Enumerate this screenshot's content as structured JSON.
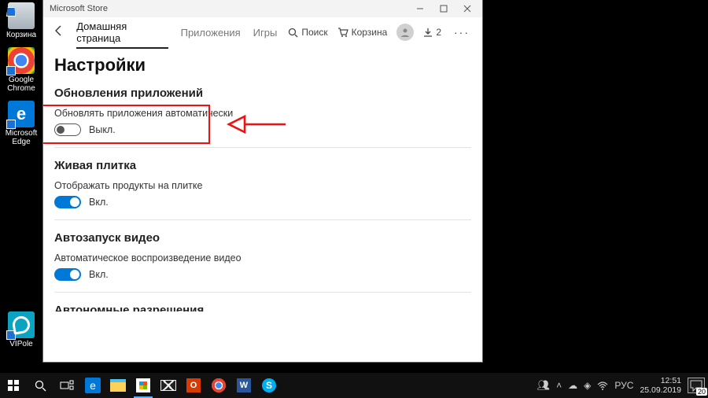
{
  "desktop": {
    "icons": [
      {
        "label": "Корзина"
      },
      {
        "label": "Google Chrome"
      },
      {
        "label": "Microsoft Edge"
      },
      {
        "label": "VIPole"
      }
    ]
  },
  "window": {
    "title": "Microsoft Store",
    "nav": {
      "tabs": [
        {
          "label": "Домашняя страница",
          "active": true
        },
        {
          "label": "Приложения",
          "active": false
        },
        {
          "label": "Игры",
          "active": false
        }
      ],
      "search": "Поиск",
      "cart": "Корзина",
      "downloads": "2"
    },
    "page_title": "Настройки",
    "sections": {
      "updates": {
        "heading": "Обновления приложений",
        "label": "Обновлять приложения автоматически",
        "state": "Выкл.",
        "on": false
      },
      "tile": {
        "heading": "Живая плитка",
        "label": "Отображать продукты на плитке",
        "state": "Вкл.",
        "on": true
      },
      "video": {
        "heading": "Автозапуск видео",
        "label": "Автоматическое воспроизведение видео",
        "state": "Вкл.",
        "on": true
      },
      "cutoff_heading": "Автономные разрешения"
    }
  },
  "taskbar": {
    "lang": "РУС",
    "time": "12:51",
    "date": "25.09.2019",
    "notif_count": "20"
  }
}
